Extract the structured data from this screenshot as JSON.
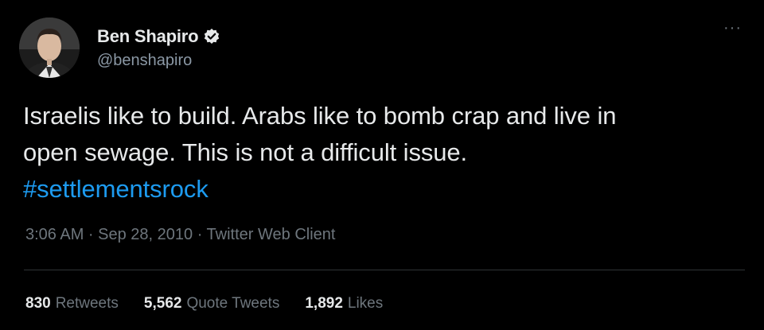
{
  "author": {
    "display_name": "Ben Shapiro",
    "handle": "@benshapiro",
    "verified_icon": "verified-badge-icon"
  },
  "menu": {
    "more_icon": "more-options-icon",
    "glyph": "···"
  },
  "tweet": {
    "line1": "Israelis like to build. Arabs like to bomb crap and live in",
    "line2": "open sewage. This is not a difficult issue.",
    "hashtag": "#settlementsrock"
  },
  "meta": {
    "text": "3:06 AM · Sep 28, 2010 · Twitter Web Client"
  },
  "stats": {
    "retweets_count": "830",
    "retweets_label": "Retweets",
    "quotes_count": "5,562",
    "quotes_label": "Quote Tweets",
    "likes_count": "1,892",
    "likes_label": "Likes"
  },
  "colors": {
    "background": "#000000",
    "text": "#e7e9ea",
    "secondary": "#6e767d",
    "link": "#1d9bf0"
  }
}
